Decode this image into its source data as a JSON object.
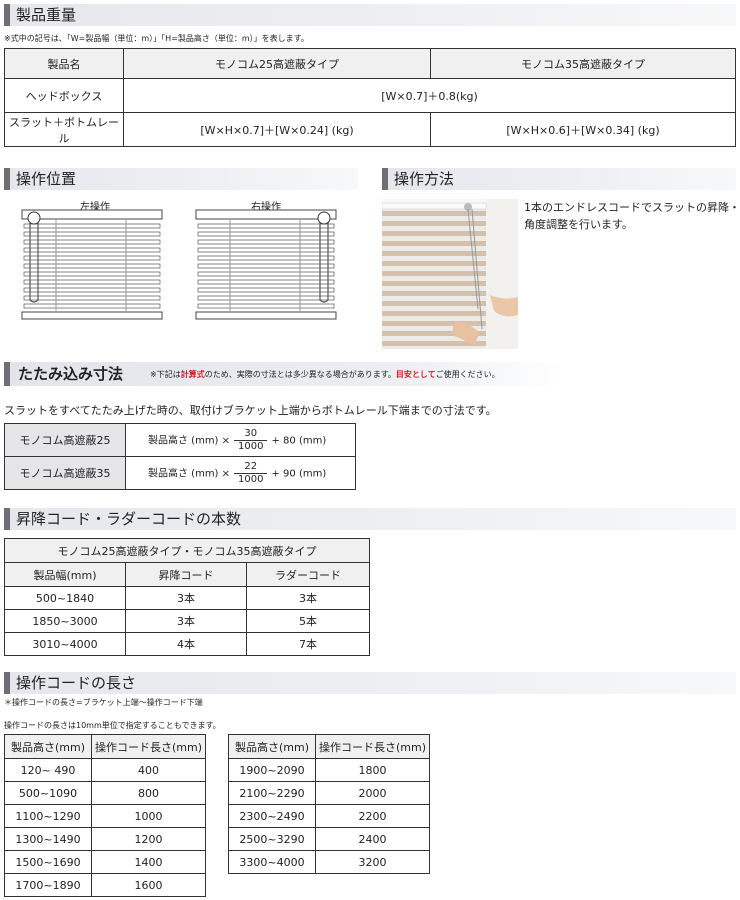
{
  "weight": {
    "title": "製品重量",
    "note": "※式中の記号は、「W=製品幅（単位：m）」「H=製品高さ（単位：m）」を表します。",
    "header": [
      "製品名",
      "モノコム25高遮蔽タイプ",
      "モノコム35高遮蔽タイプ"
    ],
    "row1": {
      "label": "ヘッドボックス",
      "formula": "[W×0.7]＋0.8(kg)"
    },
    "row2": {
      "label": "スラット＋ボトムレール",
      "formula25": "[W×H×0.7]＋[W×0.24] (kg)",
      "formula35": "[W×H×0.6]＋[W×0.34] (kg)"
    }
  },
  "position": {
    "title": "操作位置",
    "left_label": "左操作",
    "right_label": "右操作"
  },
  "method": {
    "title": "操作方法",
    "desc_line1": "1本のエンドレスコードでスラットの昇降・",
    "desc_line2": "角度調整を行います。"
  },
  "folded": {
    "title": "たたみ込み寸法",
    "note_pre": "※下記は",
    "note_red1": "計算式",
    "note_mid": "のため、実際の寸法とは多少異なる場合があります。",
    "note_red2": "目安として",
    "note_post": "ご使用ください。",
    "description": "スラットをすべてたたみ上げた時の、取付けブラケット上端からボトムレール下端までの寸法です。",
    "rows": [
      {
        "label": "モノコム高遮蔽25",
        "pre": "製品高さ (mm) ×",
        "num": "30",
        "den": "1000",
        "post": "+ 80 (mm)"
      },
      {
        "label": "モノコム高遮蔽35",
        "pre": "製品高さ (mm) ×",
        "num": "22",
        "den": "1000",
        "post": "+ 90 (mm)"
      }
    ]
  },
  "cords": {
    "title": "昇降コード・ラダーコードの本数",
    "table_title": "モノコム25高遮蔽タイプ・モノコム35高遮蔽タイプ",
    "headers": [
      "製品幅(mm)",
      "昇降コード",
      "ラダーコード"
    ],
    "rows": [
      [
        "500~1840",
        "3本",
        "3本"
      ],
      [
        "1850~3000",
        "3本",
        "5本"
      ],
      [
        "3010~4000",
        "4本",
        "7本"
      ]
    ]
  },
  "cordlen": {
    "title": "操作コードの長さ",
    "note1": "＊操作コードの長さ=ブラケット上端～操作コード下端",
    "note2": "操作コードの長さは10mm単位で指定することもできます。",
    "headers": [
      "製品高さ(mm)",
      "操作コード長さ(mm)"
    ],
    "left_rows": [
      [
        "120~  490",
        "400"
      ],
      [
        "500~1090",
        "800"
      ],
      [
        "1100~1290",
        "1000"
      ],
      [
        "1300~1490",
        "1200"
      ],
      [
        "1500~1690",
        "1400"
      ],
      [
        "1700~1890",
        "1600"
      ]
    ],
    "right_rows": [
      [
        "1900~2090",
        "1800"
      ],
      [
        "2100~2290",
        "2000"
      ],
      [
        "2300~2490",
        "2200"
      ],
      [
        "2500~3290",
        "2400"
      ],
      [
        "3300~4000",
        "3200"
      ]
    ]
  },
  "colors": {
    "accent_red": "#d0202a",
    "header_bar": "#6e6e74",
    "section_bg": "#e6e7ec"
  }
}
